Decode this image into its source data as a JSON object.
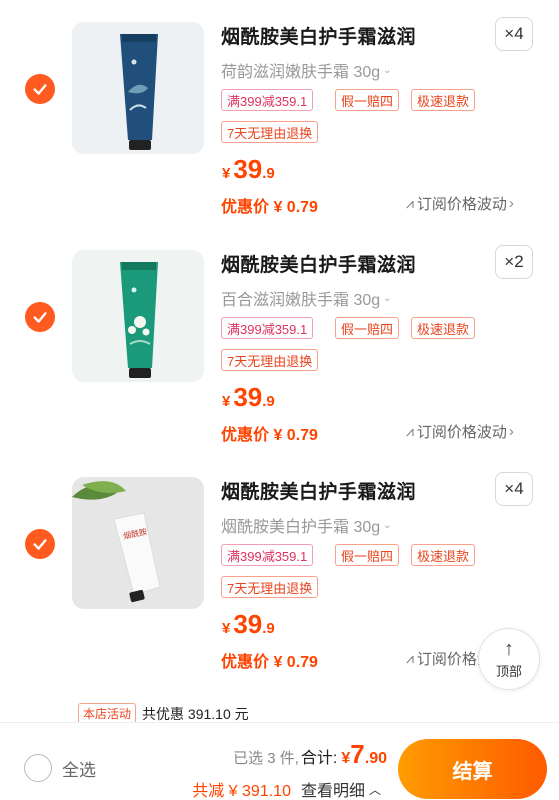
{
  "items": [
    {
      "title": "烟酰胺美白护手霜滋润",
      "quantity": "×4",
      "variant": "荷韵滋润嫩肤手霜 30g",
      "tags": [
        "满399减359.1",
        "假一赔四",
        "极速退款",
        "7天无理由退换"
      ],
      "price_symbol": "¥",
      "price_int": "39",
      "price_dec": ".9",
      "discount": "优惠价 ¥ 0.79",
      "subscribe": "订阅价格波动",
      "tube_color": "#1f4f7a",
      "bg_color": "#e9eef2"
    },
    {
      "title": "烟酰胺美白护手霜滋润",
      "quantity": "×2",
      "variant": "百合滋润嫩肤手霜 30g",
      "tags": [
        "满399减359.1",
        "假一赔四",
        "极速退款",
        "7天无理由退换"
      ],
      "price_symbol": "¥",
      "price_int": "39",
      "price_dec": ".9",
      "discount": "优惠价 ¥ 0.79",
      "subscribe": "订阅价格波动",
      "tube_color": "#1a9a7a",
      "bg_color": "#eef2f0"
    },
    {
      "title": "烟酰胺美白护手霜滋润",
      "quantity": "×4",
      "variant": "烟酰胺美白护手霜 30g",
      "tags": [
        "满399减359.1",
        "假一赔四",
        "极速退款",
        "7天无理由退换"
      ],
      "price_symbol": "¥",
      "price_int": "39",
      "price_dec": ".9",
      "discount": "优惠价 ¥ 0.79",
      "subscribe": "订阅价格波",
      "tube_color": "#f4f4f4",
      "bg_color": "#e8e8e8",
      "tube_label": "烟酰胺"
    }
  ],
  "float_top_label": "顶部",
  "shop_activity": {
    "badge": "本店活动",
    "text": "共优惠 391.10 元"
  },
  "bottom": {
    "select_all": "全选",
    "selected_count": "已选 3 件,",
    "total_label": "合计:",
    "total_symbol": "¥",
    "total_int": "7",
    "total_dec": ".90",
    "savings": "共减 ¥ 391.10",
    "details": "查看明细",
    "checkout": "结算"
  },
  "colors": {
    "accent": "#ff4400",
    "checkout_start": "#ff9c00",
    "checkout_end": "#ff5a00"
  }
}
